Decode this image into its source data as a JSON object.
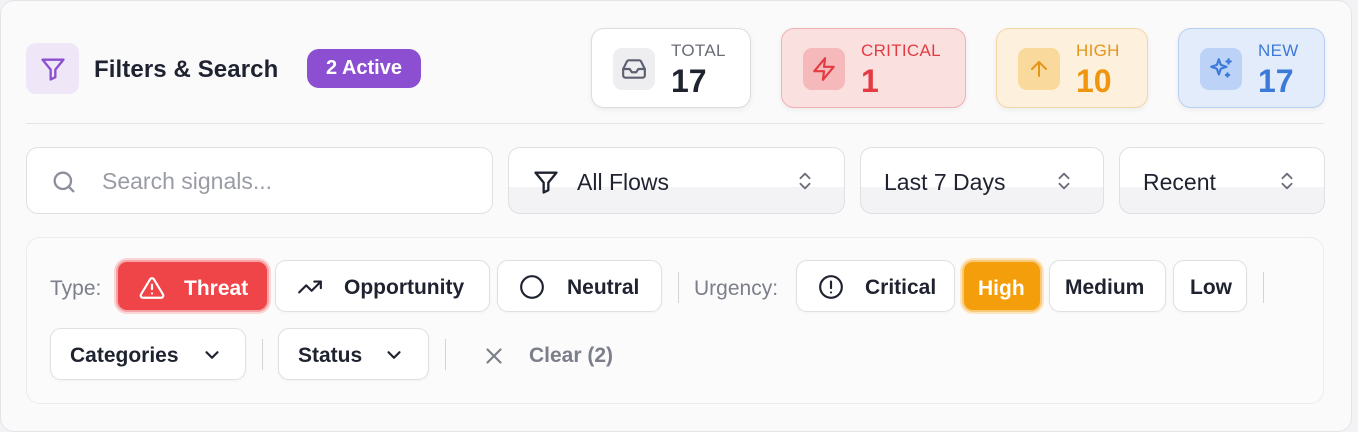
{
  "header": {
    "title": "Filters & Search",
    "active_badge": "2 Active",
    "filter_icon_color": "#8c4fd1"
  },
  "stats": {
    "total": {
      "label": "TOTAL",
      "value": "17",
      "icon": "inbox-icon"
    },
    "critical": {
      "label": "CRITICAL",
      "value": "1",
      "icon": "zap-icon",
      "color": "#e23b42"
    },
    "high": {
      "label": "HIGH",
      "value": "10",
      "icon": "arrow-up-icon",
      "color": "#f0960e"
    },
    "new": {
      "label": "NEW",
      "value": "17",
      "icon": "sparkles-icon",
      "color": "#3c7ad9"
    }
  },
  "search": {
    "placeholder": "Search signals...",
    "value": ""
  },
  "selects": {
    "flows": "All Flows",
    "date_range": "Last 7 Days",
    "sort": "Recent"
  },
  "type_filter": {
    "label": "Type:",
    "chips": [
      {
        "label": "Threat",
        "icon": "alert-triangle-icon",
        "active": true,
        "color": "#ef4448"
      },
      {
        "label": "Opportunity",
        "icon": "trending-up-icon",
        "active": false
      },
      {
        "label": "Neutral",
        "icon": "circle-icon",
        "active": false
      }
    ]
  },
  "urgency_filter": {
    "label": "Urgency:",
    "chips": [
      {
        "label": "Critical",
        "icon": "alert-circle-icon",
        "active": false
      },
      {
        "label": "High",
        "active": true,
        "color": "#f59e0b"
      },
      {
        "label": "Medium",
        "active": false
      },
      {
        "label": "Low",
        "active": false
      }
    ]
  },
  "dropdowns": {
    "categories": "Categories",
    "status": "Status"
  },
  "clear": {
    "label": "Clear (2)"
  }
}
